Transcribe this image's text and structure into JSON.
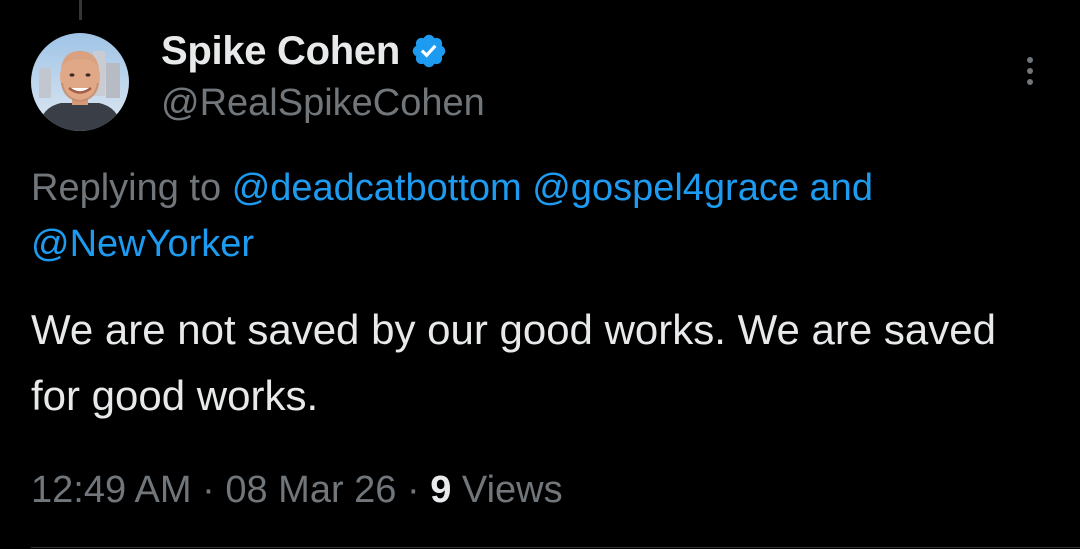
{
  "author": {
    "display_name": "Spike Cohen",
    "handle": "@RealSpikeCohen",
    "verified": true,
    "verified_icon": "verified-badge-icon",
    "avatar_description": "profile photo"
  },
  "reply": {
    "prefix": "Replying to",
    "mentions": [
      "@deadcatbottom",
      "@gospel4grace",
      "@NewYorker"
    ],
    "conjunction": "and"
  },
  "tweet": {
    "text": "We are not saved by our good works. We are saved for good works."
  },
  "meta": {
    "time": "12:49 AM",
    "separator": "·",
    "date": "08 Mar 26",
    "views_count": "9",
    "views_label": "Views"
  },
  "menu": {
    "icon": "more-options-icon"
  },
  "colors": {
    "background": "#000000",
    "text": "#e7e9ea",
    "secondary_text": "#71767b",
    "accent": "#1d9bf0"
  }
}
